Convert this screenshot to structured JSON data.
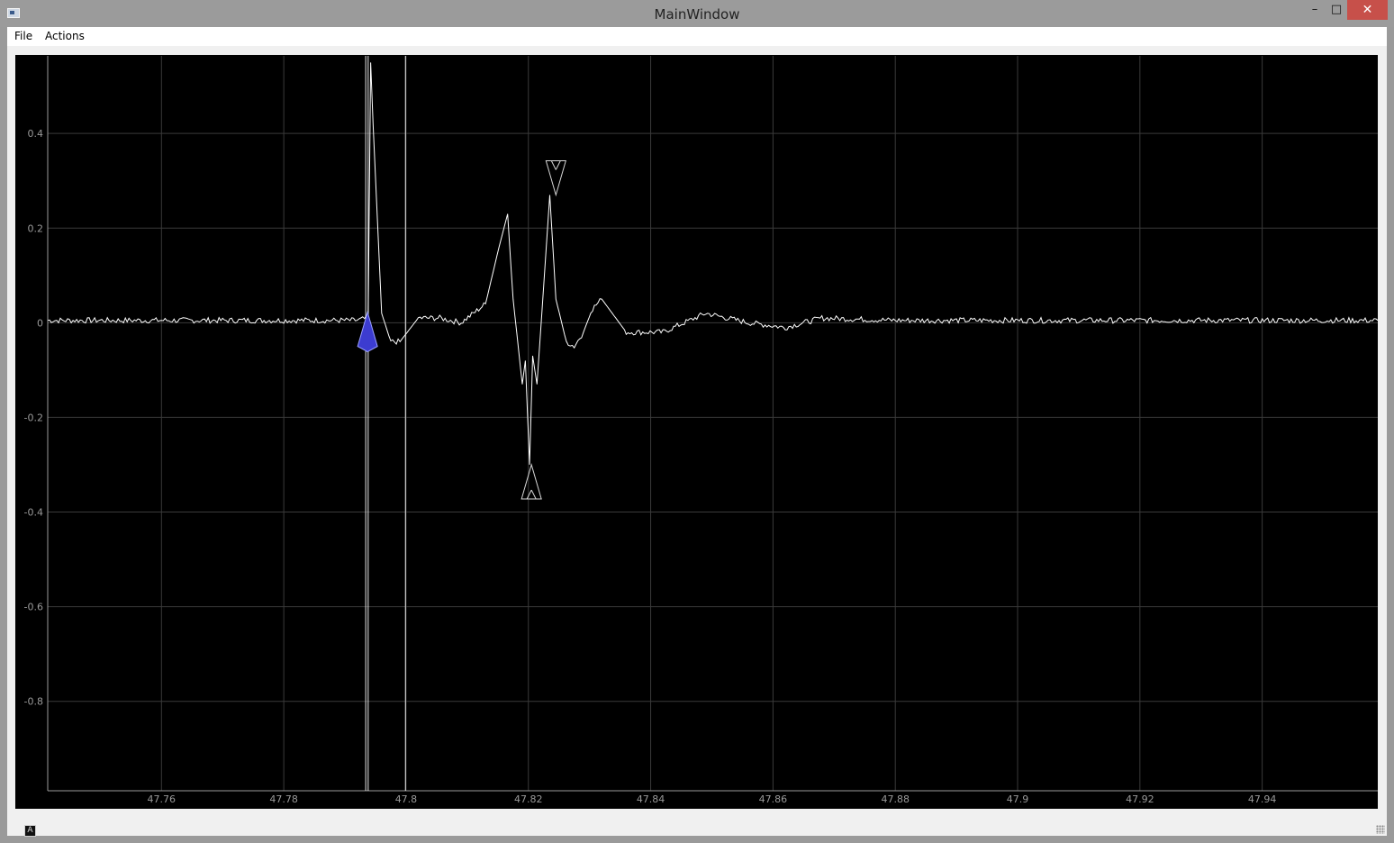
{
  "window": {
    "title": "MainWindow",
    "controls": {
      "minimize": "–",
      "maximize": "□",
      "close": "✕"
    }
  },
  "menu": {
    "items": [
      "File",
      "Actions"
    ]
  },
  "plot": {
    "auto_range_label": "A",
    "colors": {
      "background": "#000000",
      "grid": "#3a3a3a",
      "trace": "#ffffff",
      "axis_text": "#9a9a9a",
      "marker_active": "#3c3cd0"
    },
    "x_ticks": [
      "47.76",
      "47.78",
      "47.8",
      "47.82",
      "47.84",
      "47.86",
      "47.88",
      "47.9",
      "47.92",
      "47.94"
    ],
    "y_ticks": [
      "0.4",
      "0.2",
      "0",
      "-0.2",
      "-0.4",
      "-0.6",
      "-0.8"
    ]
  },
  "chart_data": {
    "type": "line",
    "title": "",
    "xlabel": "",
    "ylabel": "",
    "xlim": [
      47.7414,
      47.9589
    ],
    "ylim": [
      -0.989,
      0.564
    ],
    "grid": true,
    "x_tick_values": [
      47.76,
      47.78,
      47.8,
      47.82,
      47.84,
      47.86,
      47.88,
      47.9,
      47.92,
      47.94
    ],
    "y_tick_values": [
      0.4,
      0.2,
      0,
      -0.2,
      -0.4,
      -0.6,
      -0.8
    ],
    "series": [
      {
        "x": [
          47.7414,
          47.76,
          47.78,
          47.792,
          47.7938,
          47.7942,
          47.7946,
          47.796,
          47.7975,
          47.799,
          47.802,
          47.8055,
          47.809,
          47.813,
          47.8152,
          47.8166,
          47.8175,
          47.819,
          47.8195,
          47.8202,
          47.8207,
          47.8214,
          47.8222,
          47.8235,
          47.8245,
          47.8262,
          47.8275,
          47.829,
          47.8305,
          47.832,
          47.836,
          47.839,
          47.842,
          47.849,
          47.856,
          47.862,
          47.868,
          47.88,
          47.9,
          47.92,
          47.94,
          47.9589
        ],
        "y": [
          0.005,
          0.005,
          0.005,
          0.005,
          0.01,
          0.55,
          0.42,
          0.02,
          -0.04,
          -0.04,
          0.01,
          0.01,
          0.0,
          0.04,
          0.16,
          0.23,
          0.05,
          -0.13,
          -0.08,
          -0.3,
          -0.07,
          -0.13,
          0.02,
          0.27,
          0.05,
          -0.04,
          -0.05,
          -0.02,
          0.03,
          0.05,
          -0.02,
          -0.02,
          -0.02,
          0.02,
          0.0,
          -0.01,
          0.01,
          0.005,
          0.005,
          0.005,
          0.005,
          0.005
        ]
      }
    ],
    "markers": [
      {
        "shape": "diamond",
        "x": 47.7937,
        "y": -0.05,
        "color": "#3c3cd0"
      },
      {
        "shape": "peak-triangle",
        "x": 47.8245,
        "y": 0.27,
        "color": "none"
      },
      {
        "shape": "trough-triangle",
        "x": 47.8205,
        "y": -0.3,
        "color": "none"
      }
    ],
    "vertical_lines": [
      47.7934,
      47.7938,
      47.7999
    ]
  }
}
